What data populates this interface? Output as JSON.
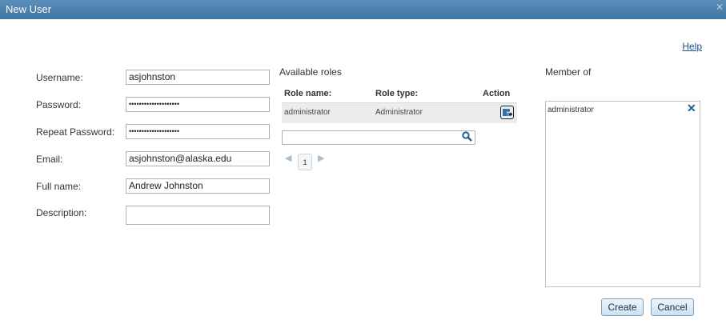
{
  "window": {
    "title": "New User",
    "close_glyph": "⨯"
  },
  "help_link": "Help",
  "form": {
    "username": {
      "label": "Username:",
      "value": "asjohnston"
    },
    "password": {
      "label": "Password:",
      "value": "••••••••••••••••••••"
    },
    "repeat_password": {
      "label": "Repeat Password:",
      "value": "••••••••••••••••••••"
    },
    "email": {
      "label": "Email:",
      "value": "asjohnston@alaska.edu"
    },
    "full_name": {
      "label": "Full name:",
      "value": "Andrew Johnston"
    },
    "description": {
      "label": "Description:",
      "value": ""
    }
  },
  "available_roles": {
    "title": "Available roles",
    "columns": [
      "Role name:",
      "Role type:",
      "Action"
    ],
    "rows": [
      {
        "name": "administrator",
        "type": "Administrator",
        "action_icon": "add-role-icon"
      }
    ],
    "search_value": "",
    "pager": {
      "current_page": "1"
    }
  },
  "member_of": {
    "title": "Member of",
    "items": [
      {
        "name": "administrator",
        "remove_glyph": "✕"
      }
    ]
  },
  "buttons": {
    "create": "Create",
    "cancel": "Cancel"
  },
  "colors": {
    "titlebar": "#4a80ad",
    "accent": "#1c5f8c"
  }
}
